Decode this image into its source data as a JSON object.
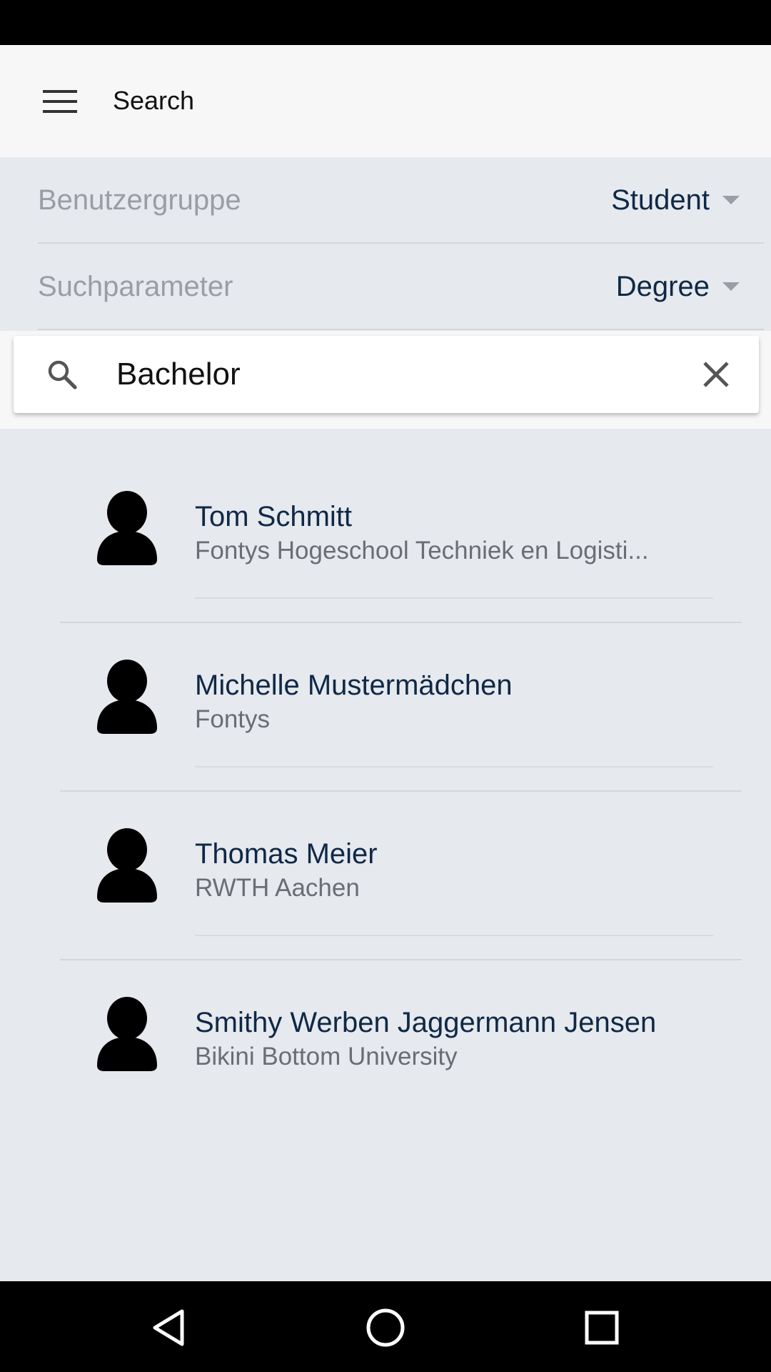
{
  "app_bar": {
    "title": "Search",
    "menu_icon": "hamburger-menu-icon"
  },
  "filters": {
    "user_group": {
      "label": "Benutzergruppe",
      "value": "Student"
    },
    "search_param": {
      "label": "Suchparameter",
      "value": "Degree"
    }
  },
  "search": {
    "value": "Bachelor",
    "search_icon": "search-icon",
    "clear_icon": "close-icon"
  },
  "results": [
    {
      "name": "Tom Schmitt",
      "subtitle": "Fontys Hogeschool Techniek en Logisti..."
    },
    {
      "name": "Michelle Mustermädchen",
      "subtitle": "Fontys"
    },
    {
      "name": "Thomas Meier",
      "subtitle": "RWTH Aachen"
    },
    {
      "name": "Smithy Werben Jaggermann Jensen",
      "subtitle": "Bikini Bottom University"
    }
  ],
  "nav_bar": {
    "back_icon": "back-triangle-icon",
    "home_icon": "home-circle-icon",
    "recents_icon": "recents-square-icon"
  },
  "colors": {
    "accent_text": "#0f2846",
    "panel_bg": "#e6e9ee",
    "app_bar_bg": "#f7f7f7"
  }
}
